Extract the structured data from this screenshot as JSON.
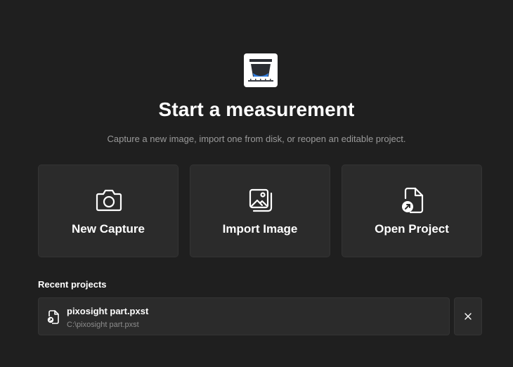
{
  "header": {
    "logo_icon": "pixosight-logo-icon",
    "title": "Start a measurement",
    "subtitle": "Capture a new image, import one from disk, or reopen an editable project."
  },
  "actions": [
    {
      "label": "New Capture",
      "icon": "camera-icon"
    },
    {
      "label": "Import Image",
      "icon": "images-icon"
    },
    {
      "label": "Open Project",
      "icon": "open-file-icon"
    }
  ],
  "recent": {
    "heading": "Recent projects",
    "items": [
      {
        "name": "pixosight part.pxst",
        "path": "C:\\pixosight part.pxst",
        "icon": "project-file-icon"
      }
    ],
    "remove_icon": "close-icon"
  },
  "colors": {
    "background": "#1f1f1f",
    "card": "#2b2b2b",
    "card_border": "#343434",
    "accent": "#2f7de1",
    "muted_text": "#9a9a9a"
  }
}
